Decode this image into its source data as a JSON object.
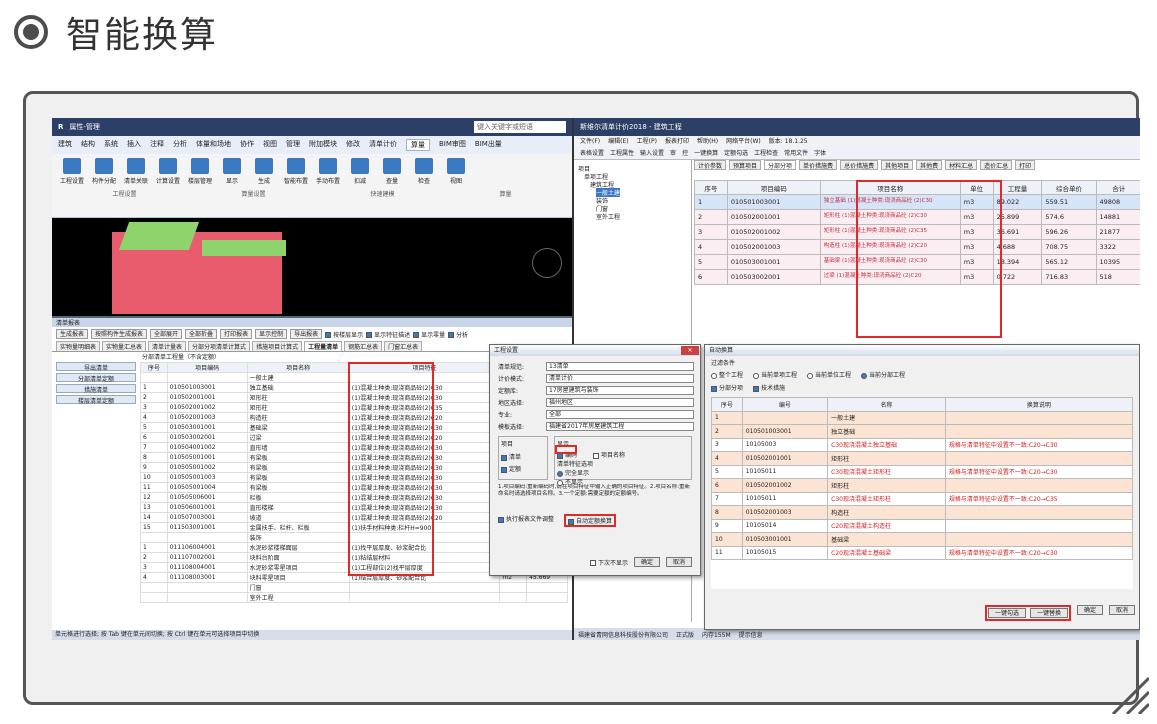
{
  "header": {
    "title": "智能换算"
  },
  "left_app": {
    "title": "属性-管理",
    "search_placeholder": "键入关键字或短语",
    "ribbon_tabs": [
      "建筑",
      "结构",
      "系统",
      "插入",
      "注释",
      "分析",
      "体量和场地",
      "协作",
      "视图",
      "管理",
      "附加模块",
      "修改",
      "清单计价",
      "算量",
      "BIM审图",
      "BIM出量"
    ],
    "ribbon_buttons": [
      "工程设置",
      "构件分配",
      "清单关联",
      "计算设置",
      "楼层管理",
      "显示",
      "生成",
      "智能布置",
      "手动布置",
      "扣减",
      "查量",
      "检查",
      "视图"
    ],
    "ribbon_groups": [
      "工程设置",
      "算量设置",
      "快速建模",
      "算量"
    ],
    "palette_title": "清单报表",
    "palette_tools": [
      "生成报表",
      "按照构件生成报表",
      "全部展开",
      "全部折叠",
      "打印报表",
      "显示控制",
      "导出报表"
    ],
    "palette_options": [
      "按楼层显示",
      "显示特征描述",
      "显示零量",
      "分析"
    ],
    "palette_tabs": [
      "实物量明细表",
      "实物量汇总表",
      "清单计量表",
      "分部分项清单计算式",
      "措施项目计算式",
      "工程量清单",
      "钢筋汇总表",
      "门窗汇总表"
    ],
    "side_buttons": [
      "导出清单",
      "分部清单定额",
      "措施清单",
      "楼层清单定额"
    ],
    "table_caption": "分部清单工程量（不含定额）",
    "table_headers": [
      "序号",
      "项目编码",
      "项目名称",
      "项目特征",
      "单位",
      "工程量"
    ],
    "rows": [
      [
        "",
        "",
        "一般土建",
        "",
        "",
        ""
      ],
      [
        "1",
        "010501003001",
        "独立基础",
        "(1)混凝土种类:现浇商品砼(2)C30",
        "m3",
        "89.022"
      ],
      [
        "2",
        "010502001001",
        "矩形柱",
        "(1)混凝土种类:现浇商品砼(2)C30",
        "m3",
        "25.899"
      ],
      [
        "3",
        "010502001002",
        "矩形柱",
        "(1)混凝土种类:现浇商品砼(2)C35",
        "m3",
        "36.691"
      ],
      [
        "4",
        "010502001003",
        "构造柱",
        "(1)混凝土种类:现浇商品砼(2)C20",
        "m3",
        "4.688"
      ],
      [
        "5",
        "010503001001",
        "基础梁",
        "(1)混凝土种类:现浇商品砼(2)C30",
        "m3",
        "18.394"
      ],
      [
        "6",
        "010503002001",
        "过梁",
        "(1)混凝土种类:现浇商品砼(2)C20",
        "m3",
        "0.722"
      ],
      [
        "7",
        "010504001002",
        "直形墙",
        "(1)混凝土种类:现浇商品砼(2)C30",
        "m3",
        "14.857"
      ],
      [
        "8",
        "010505001001",
        "有梁板",
        "(1)混凝土种类:现浇商品砼(2)C30",
        "m3",
        "24.112"
      ],
      [
        "9",
        "010505001002",
        "有梁板",
        "(1)混凝土种类:现浇商品砼(2)C30",
        "m3",
        "35.374"
      ],
      [
        "10",
        "010505001003",
        "有梁板",
        "(1)混凝土种类:现浇商品砼(2)C30",
        "m3",
        "1.574"
      ],
      [
        "11",
        "010505001004",
        "有梁板",
        "(1)混凝土种类:现浇商品砼(2)C30",
        "m3",
        "3.756"
      ],
      [
        "12",
        "010505006001",
        "栏板",
        "(1)混凝土种类:现浇商品砼(2)C30",
        "m3",
        "3.055"
      ],
      [
        "13",
        "010506001001",
        "直形楼梯",
        "(1)混凝土种类:现浇商品砼(2)C30",
        "m2",
        "30.476"
      ],
      [
        "14",
        "010507003001",
        "坡道",
        "(1)混凝土种类:现浇商品砼(2)C20",
        "m3",
        "0.08"
      ],
      [
        "15",
        "011503001001",
        "金属扶手、栏杆、栏板",
        "(1)扶手材料种类:栏杆H=900",
        "m",
        "60.503"
      ],
      [
        "",
        "",
        "装饰",
        "",
        "",
        ""
      ],
      [
        "1",
        "011106004001",
        "水泥砂浆楼梯面层",
        "(1)找平层厚度、砂浆配合比",
        "m2",
        "30.476"
      ],
      [
        "2",
        "011107002001",
        "块料台阶面",
        "(1)粘结层材料",
        "m2",
        "0.772"
      ],
      [
        "3",
        "011108004001",
        "水泥砂浆零星项目",
        "(1)工程部位(2)找平层厚度",
        "m2",
        "4.154"
      ],
      [
        "4",
        "011108003001",
        "块料零星项目",
        "(1)结合层厚度、砂浆配合比",
        "m2",
        "45.669"
      ],
      [
        "",
        "",
        "门窗",
        "",
        "",
        ""
      ],
      [
        "",
        "",
        "室外工程",
        "",
        "",
        ""
      ]
    ],
    "status": "单元格进行选择; 按 Tab 键在单元间切换; 按 Ctrl 键在单元可选择项目中切换"
  },
  "right_app": {
    "title": "斯维尔清单计价2018 - 建筑工程",
    "menu": [
      "文件(F)",
      "编辑(E)",
      "工程(P)",
      "报表打印",
      "帮助(H)",
      "网络平台(W)",
      "版本: 18.1.25"
    ],
    "toolbar": [
      "表格设置",
      "工程属性",
      "输入设置",
      "审",
      "控",
      "一键换算",
      "定额勾选",
      "工程检查",
      "常用文件",
      "字体"
    ],
    "tree": [
      "项目",
      "单项工程",
      "建筑工程",
      "一般土建",
      "装饰",
      "门窗",
      "室外工程"
    ],
    "tabs": [
      "计价参数",
      "预算项目",
      "分部分项",
      "单价措施费",
      "总价措施费",
      "其他项目",
      "其他费",
      "材料汇总",
      "造价汇总",
      "打印"
    ],
    "headers": [
      "序号",
      "项目编码",
      "项目名称",
      "单位",
      "工程量",
      "综合单价",
      "合计"
    ],
    "rows": [
      [
        "1",
        "010501003001",
        "独立基础 (1)混凝土种类:现浇商品砼 (2)C30",
        "m3",
        "89.022",
        "559.51",
        "49808"
      ],
      [
        "2",
        "010502001001",
        "矩形柱 (1)混凝土种类:现浇商品砼 (2)C30",
        "m3",
        "25.899",
        "574.6",
        "14881"
      ],
      [
        "3",
        "010502001002",
        "矩形柱 (1)混凝土种类:现浇商品砼 (2)C35",
        "m3",
        "36.691",
        "596.26",
        "21877"
      ],
      [
        "4",
        "010502001003",
        "构造柱 (1)混凝土种类:现浇商品砼 (2)C20",
        "m3",
        "4.688",
        "708.75",
        "3322"
      ],
      [
        "5",
        "010503001001",
        "基础梁 (1)混凝土种类:现浇商品砼 (2)C30",
        "m3",
        "18.394",
        "565.12",
        "10395"
      ],
      [
        "6",
        "010503002001",
        "过梁 (1)混凝土种类:现浇商品砼 (2)C20",
        "m3",
        "0.722",
        "716.83",
        "518"
      ]
    ],
    "status": [
      "福建省青网信息科技股份有限公司",
      "正式版",
      "内存155M",
      "提示信息"
    ]
  },
  "dialog_settings": {
    "title": "工程设置",
    "fields": [
      {
        "label": "清单规范:",
        "value": "13清单"
      },
      {
        "label": "计价模式:",
        "value": "清单计价"
      },
      {
        "label": "定额库:",
        "value": "17房屋建筑与装饰"
      },
      {
        "label": "地区选择:",
        "value": "福州地区"
      },
      {
        "label": "专业:",
        "value": "全部"
      },
      {
        "label": "模板选择:",
        "value": "福建省2017年房屋建筑工程"
      }
    ],
    "section_item": "项目",
    "chk_list": "清单",
    "chk_quota": "定额",
    "section_opt": "显示",
    "opt_code": "编码",
    "opt_name": "项目名称",
    "opt_desc": "清单特征选项",
    "opt_full": "完全显示",
    "opt_hide": "不显示",
    "note": "1.项目编码:重新编码时,请在项目特征中输入正确的项目特征。2.项目名称:重新命名时请选择项目名称。3.一个定额:需要定额的定额编号。",
    "chk_exec": "执行报表文件调整",
    "chk_auto": "自动定额换算",
    "chk_noshow": "下次不显示",
    "btn_ok": "确定",
    "btn_cancel": "取消"
  },
  "dialog_convert": {
    "title": "自动换算",
    "section": "过滤条件",
    "radios": [
      "整个工程",
      "当前单项工程",
      "当前单位工程",
      "当前分部工程"
    ],
    "filters": [
      "分部分项",
      "技术措施"
    ],
    "headers": [
      "序号",
      "编号",
      "名称",
      "换算说明"
    ],
    "rows": [
      [
        "1",
        "",
        "一般土建",
        ""
      ],
      [
        "2",
        "010501003001",
        "独立基础",
        ""
      ],
      [
        "3",
        "10105003",
        "C30现浇混凝土独立基础",
        "规格与清单特征中设置不一致:C20→C30"
      ],
      [
        "4",
        "010502001001",
        "矩形柱",
        ""
      ],
      [
        "5",
        "10105011",
        "C30现浇混凝土矩形柱",
        "规格与清单特征中设置不一致:C20→C30"
      ],
      [
        "6",
        "010502001002",
        "矩形柱",
        ""
      ],
      [
        "7",
        "10105011",
        "C30现浇混凝土矩形柱",
        "规格与清单特征中设置不一致:C20→C35"
      ],
      [
        "8",
        "010502001003",
        "构造柱",
        ""
      ],
      [
        "9",
        "10105014",
        "C20现浇混凝土构造柱",
        ""
      ],
      [
        "10",
        "010503001001",
        "基础梁",
        ""
      ],
      [
        "11",
        "10105015",
        "C20现浇混凝土基础梁",
        "规格与清单特征中设置不一致:C20→C30"
      ]
    ],
    "btn_check": "一键勾选",
    "btn_replace": "一键替换",
    "btn_ok": "确定",
    "btn_cancel": "取消"
  },
  "colors": {
    "accent": "#e02a2a",
    "frame": "#555555",
    "blue": "#3a78c2"
  }
}
